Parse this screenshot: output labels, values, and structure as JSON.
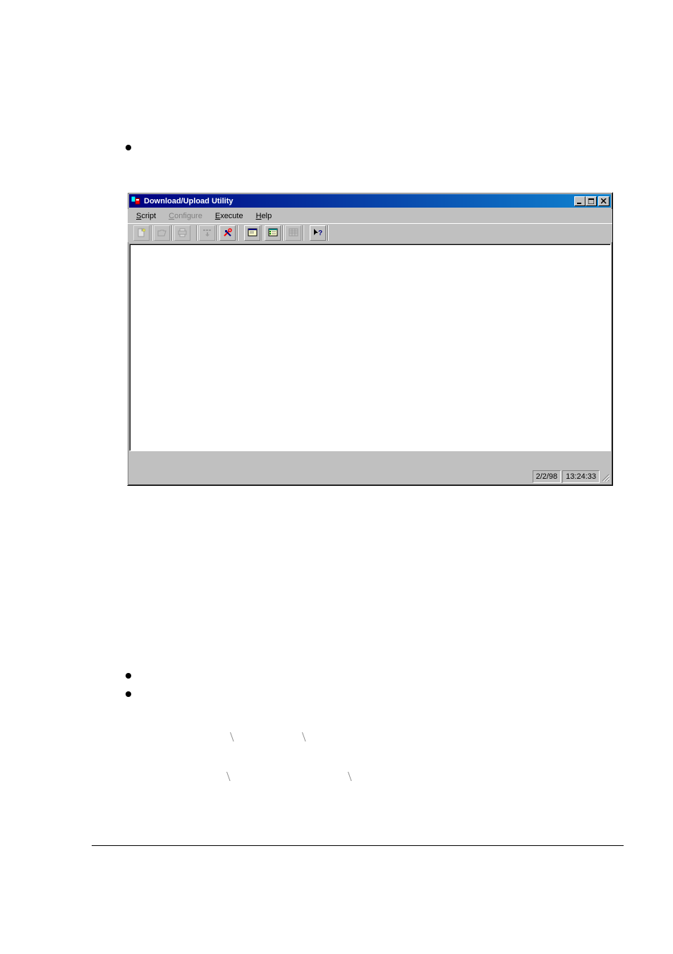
{
  "window": {
    "title": "Download/Upload Utility"
  },
  "menubar": {
    "script": {
      "label": "Script",
      "accel_pos": 0
    },
    "configure": {
      "label": "Configure",
      "accel_pos": 0
    },
    "execute": {
      "label": "Execute",
      "accel_pos": 0
    },
    "help": {
      "label": "Help",
      "accel_pos": 0
    }
  },
  "toolbar": {
    "icons": {
      "new": "new-document-icon",
      "open": "open-folder-icon",
      "print": "printer-icon",
      "download": "download-arrows-icon",
      "execute": "tools-icon",
      "window1": "document-window-icon",
      "window2": "list-window-icon",
      "window3": "grid-window-icon",
      "help": "context-help-icon"
    }
  },
  "statusbar": {
    "date": "2/2/98",
    "time": "13:24:33"
  }
}
